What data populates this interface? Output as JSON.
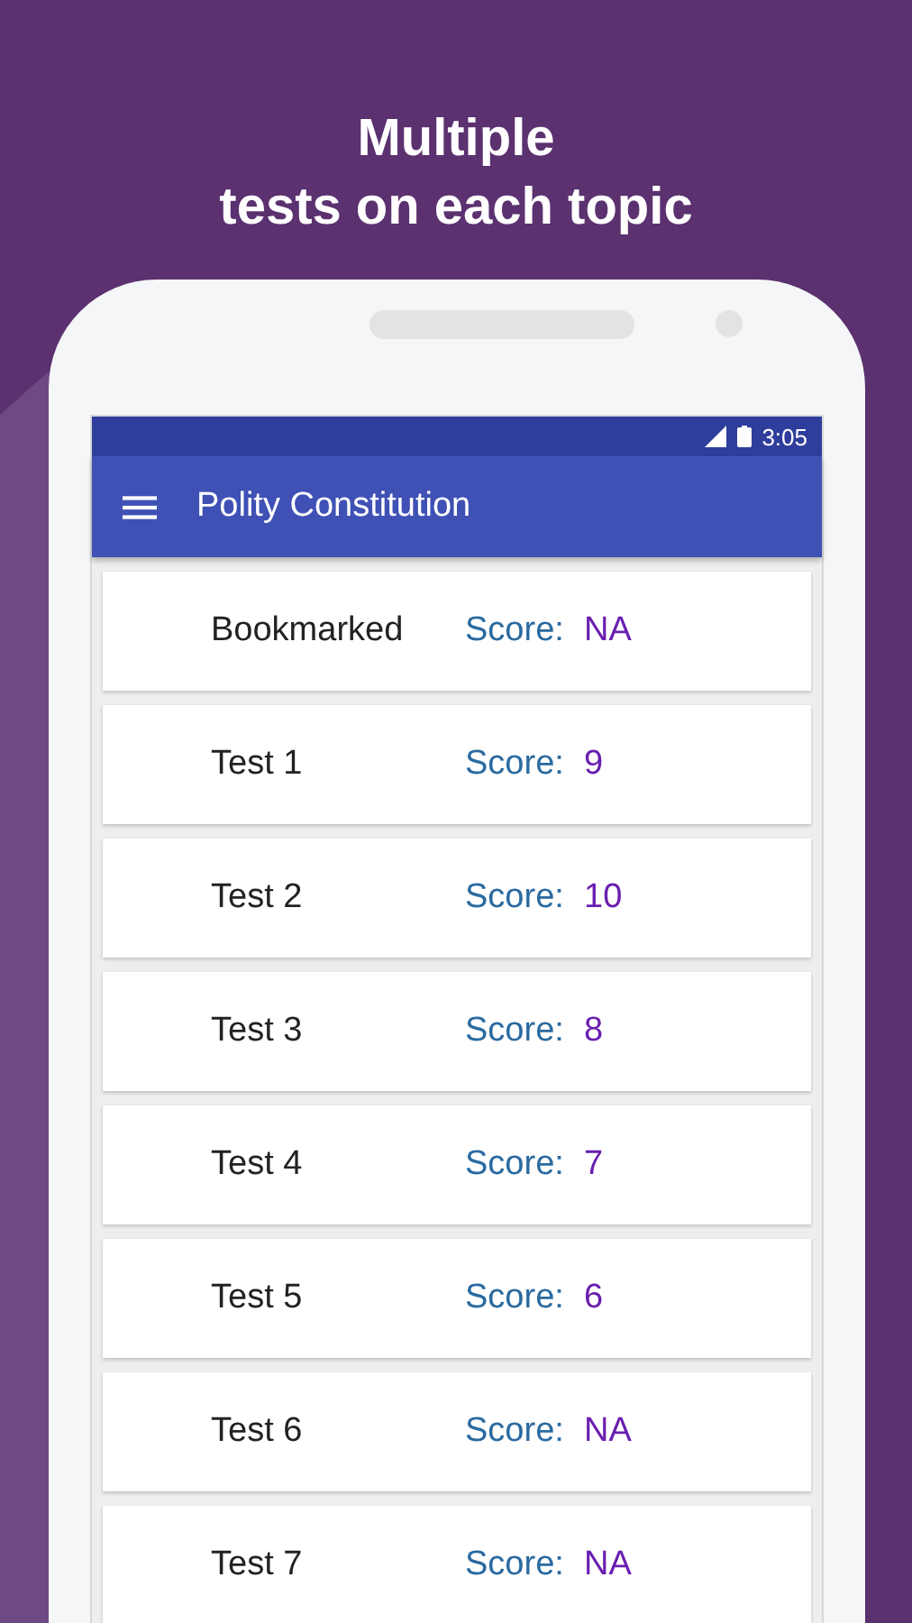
{
  "headline": [
    "Multiple",
    "tests on each topic"
  ],
  "status_bar": {
    "time": "3:05"
  },
  "toolbar": {
    "title": "Polity Constitution"
  },
  "tests": [
    {
      "name": "Bookmarked",
      "score_label": "Score:",
      "score": "NA"
    },
    {
      "name": "Test 1",
      "score_label": "Score:",
      "score": "9"
    },
    {
      "name": "Test 2",
      "score_label": "Score:",
      "score": "10"
    },
    {
      "name": "Test 3",
      "score_label": "Score:",
      "score": "8"
    },
    {
      "name": "Test 4",
      "score_label": "Score:",
      "score": "7"
    },
    {
      "name": "Test 5",
      "score_label": "Score:",
      "score": "6"
    },
    {
      "name": "Test 6",
      "score_label": "Score:",
      "score": "NA"
    },
    {
      "name": "Test 7",
      "score_label": "Score:",
      "score": "NA"
    }
  ]
}
